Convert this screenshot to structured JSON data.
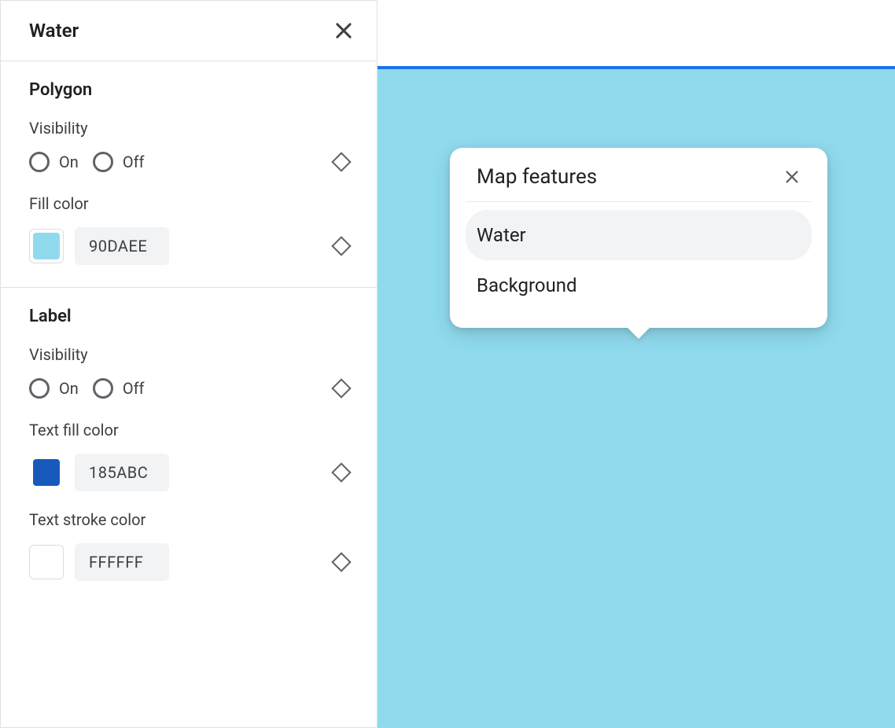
{
  "panel": {
    "title": "Water",
    "sections": {
      "polygon": {
        "title": "Polygon",
        "visibility": {
          "label": "Visibility",
          "options": {
            "on": "On",
            "off": "Off"
          }
        },
        "fill_color": {
          "label": "Fill color",
          "hex": "90DAEE",
          "swatch": "#90DAEE"
        }
      },
      "label": {
        "title": "Label",
        "visibility": {
          "label": "Visibility",
          "options": {
            "on": "On",
            "off": "Off"
          }
        },
        "text_fill_color": {
          "label": "Text fill color",
          "hex": "185ABC",
          "swatch": "#185ABC"
        },
        "text_stroke_color": {
          "label": "Text stroke color",
          "hex": "FFFFFF",
          "swatch": "#FFFFFF"
        }
      }
    }
  },
  "map": {
    "water_color": "#90DAEE",
    "accent": "#1a73e8"
  },
  "popup": {
    "title": "Map features",
    "items": [
      {
        "label": "Water",
        "selected": true
      },
      {
        "label": "Background",
        "selected": false
      }
    ]
  }
}
